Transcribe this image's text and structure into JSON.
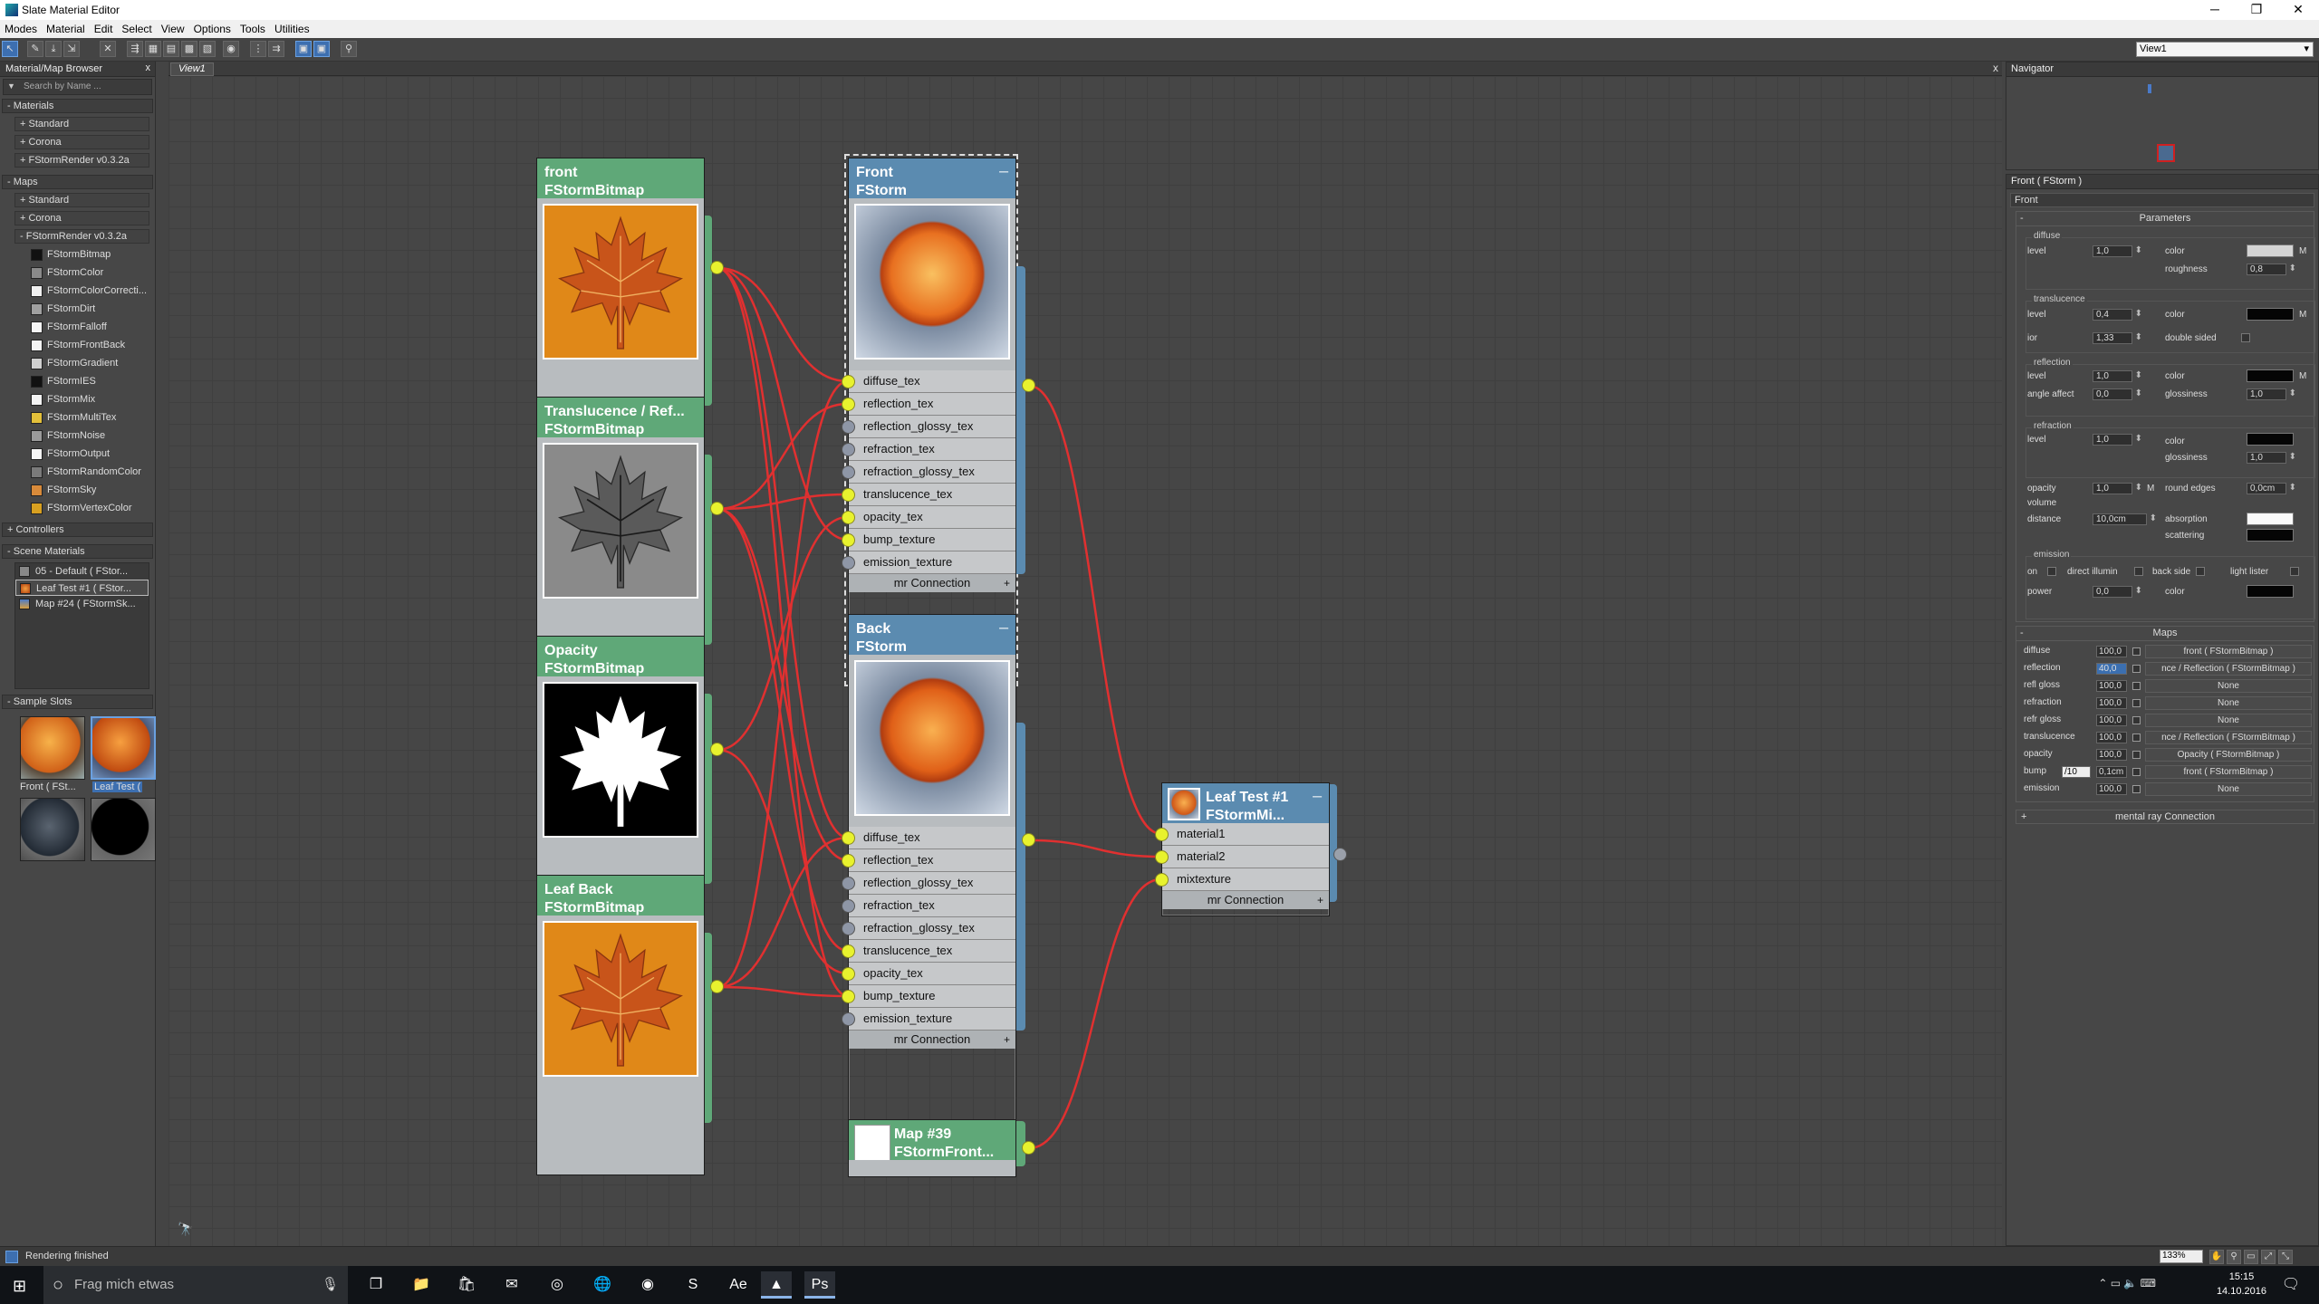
{
  "window": {
    "title": "Slate Material Editor",
    "btn_min": "─",
    "btn_max": "❐",
    "btn_close": "✕"
  },
  "menu": [
    "Modes",
    "Material",
    "Edit",
    "Select",
    "View",
    "Options",
    "Tools",
    "Utilities"
  ],
  "toolbar": {
    "view_select": "View1"
  },
  "browser": {
    "title": "Material/Map Browser",
    "close": "x",
    "search_placeholder": "Search by Name ...",
    "materials_header": "- Materials",
    "materials": [
      "+ Standard",
      "+ Corona",
      "+ FStormRender v0.3.2a"
    ],
    "maps_header": "- Maps",
    "maps_groups": [
      "+ Standard",
      "+ Corona",
      "- FStormRender v0.3.2a"
    ],
    "fstorm_maps": [
      {
        "label": "FStormBitmap",
        "color": "#111111"
      },
      {
        "label": "FStormColor",
        "color": "#8a8a8a"
      },
      {
        "label": "FStormColorCorrecti...",
        "color": "#f0f0f0"
      },
      {
        "label": "FStormDirt",
        "color": "#a0a0a0"
      },
      {
        "label": "FStormFalloff",
        "color": "#f4f4f4"
      },
      {
        "label": "FStormFrontBack",
        "color": "#f4f4f4"
      },
      {
        "label": "FStormGradient",
        "color": "#cfcfcf"
      },
      {
        "label": "FStormIES",
        "color": "#111111"
      },
      {
        "label": "FStormMix",
        "color": "#f4f4f4"
      },
      {
        "label": "FStormMultiTex",
        "color": "#e3c03a"
      },
      {
        "label": "FStormNoise",
        "color": "#9a9a9a"
      },
      {
        "label": "FStormOutput",
        "color": "#f4f4f4"
      },
      {
        "label": "FStormRandomColor",
        "color": "#7a7a7a"
      },
      {
        "label": "FStormSky",
        "color": "#d88a3a"
      },
      {
        "label": "FStormVertexColor",
        "color": "#d8a020"
      }
    ],
    "controllers_header": "+ Controllers",
    "scene_header": "- Scene Materials",
    "scene_materials": [
      "05 - Default  ( FStor...",
      "Leaf Test #1  ( FStor...",
      "Map #24  ( FStormSk..."
    ],
    "slots_header": "- Sample Slots",
    "slot_labels": [
      "Front  ( FSt...",
      "Leaf Test ("
    ]
  },
  "view": {
    "tab": "View1",
    "close": "x"
  },
  "nodes": {
    "front_bmp": {
      "name": "front",
      "type": "FStormBitmap"
    },
    "transl_bmp": {
      "name": "Translucence / Ref...",
      "type": "FStormBitmap"
    },
    "opacity_bmp": {
      "name": "Opacity",
      "type": "FStormBitmap"
    },
    "leafback_bmp": {
      "name": "Leaf Back",
      "type": "FStormBitmap"
    },
    "front_mat": {
      "name": "Front",
      "type": "FStorm"
    },
    "back_mat": {
      "name": "Back",
      "type": "FStorm"
    },
    "mix": {
      "name": "Leaf Test #1",
      "type": "FStormMi..."
    },
    "map39": {
      "name": "Map #39",
      "type": "FStormFront..."
    },
    "minimize": "─",
    "mat_slots": [
      "diffuse_tex",
      "reflection_tex",
      "reflection_glossy_tex",
      "refraction_tex",
      "refraction_glossy_tex",
      "translucence_tex",
      "opacity_tex",
      "bump_texture",
      "emission_texture"
    ],
    "mix_slots": [
      "material1",
      "material2",
      "mixtexture"
    ],
    "connection": "mr Connection",
    "plus": "+"
  },
  "navigator": {
    "title": "Navigator"
  },
  "params": {
    "title": "Front  ( FStorm )",
    "name_value": "Front",
    "section": "Parameters",
    "diffuse": {
      "label": "diffuse",
      "level_l": "level",
      "level": "1,0",
      "color_l": "color",
      "rough_l": "roughness",
      "rough": "0,8",
      "m": "M"
    },
    "transl": {
      "label": "translucence",
      "level_l": "level",
      "level": "0,4",
      "color_l": "color",
      "ior_l": "ior",
      "ior": "1,33",
      "ds_l": "double sided",
      "m": "M"
    },
    "refl": {
      "label": "reflection",
      "level_l": "level",
      "level": "1,0",
      "color_l": "color",
      "angle_l": "angle affect",
      "angle": "0,0",
      "gloss_l": "glossiness",
      "gloss": "1,0",
      "m": "M"
    },
    "refr": {
      "label": "refraction",
      "level_l": "level",
      "level": "1,0",
      "color_l": "color",
      "gloss_l": "glossiness",
      "gloss": "1,0"
    },
    "misc": {
      "opacity_l": "opacity",
      "opacity": "1,0",
      "m": "M",
      "round_l": "round edges",
      "round": "0,0cm",
      "volume_l": "volume",
      "dist_l": "distance",
      "dist": "10,0cm",
      "abs_l": "absorption",
      "scat_l": "scattering"
    },
    "emission": {
      "label": "emission",
      "on_l": "on",
      "direct_l": "direct illumin",
      "back_l": "back side",
      "lister_l": "light lister",
      "power_l": "power",
      "power": "0,0",
      "color_l": "color"
    },
    "maps_section": "Maps",
    "maps": [
      {
        "label": "diffuse",
        "value": "100,0",
        "map": "front  ( FStormBitmap )"
      },
      {
        "label": "reflection",
        "value": "40,0",
        "map": "nce / Reflection  ( FStormBitmap )",
        "hl": true
      },
      {
        "label": "refl gloss",
        "value": "100,0",
        "map": "None"
      },
      {
        "label": "refraction",
        "value": "100,0",
        "map": "None"
      },
      {
        "label": "refr gloss",
        "value": "100,0",
        "map": "None"
      },
      {
        "label": "translucence",
        "value": "100,0",
        "map": "nce / Reflection  ( FStormBitmap )"
      },
      {
        "label": "opacity",
        "value": "100,0",
        "map": "Opacity  ( FStormBitmap )"
      },
      {
        "label": "bump",
        "value": "0,1cm",
        "map": "front  ( FStormBitmap )",
        "extra": "/10"
      },
      {
        "label": "emission",
        "value": "100,0",
        "map": "None"
      }
    ],
    "mr_connection": "mental ray Connection",
    "mr_plus": "+"
  },
  "status": {
    "text": "Rendering finished",
    "zoom": "133%"
  },
  "taskbar": {
    "search": "Frag mich etwas",
    "time": "15:15",
    "date": "14.10.2016"
  },
  "colors": {
    "yellow_port": "#e8f22e",
    "wire": "#e03030",
    "bitmap_head": "#5fa878",
    "material_head": "#5b8bb0"
  }
}
